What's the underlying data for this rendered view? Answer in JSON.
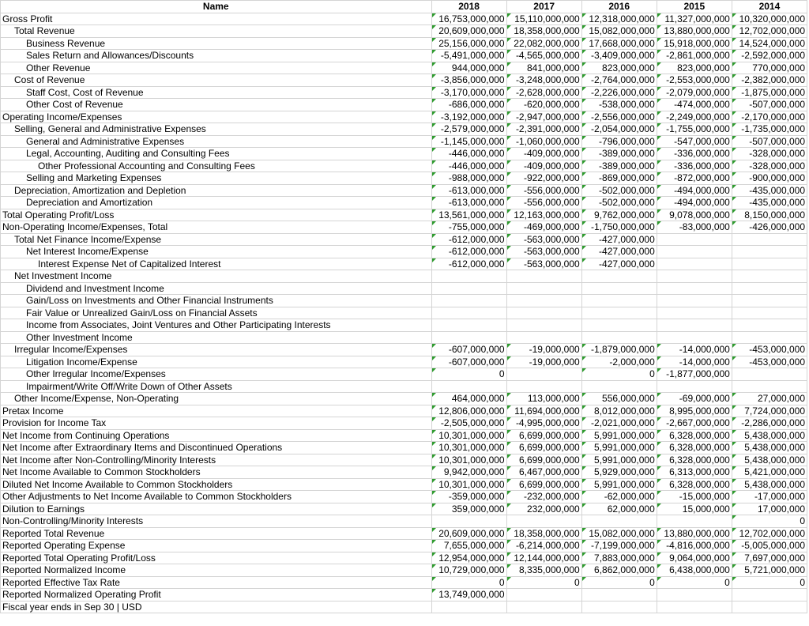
{
  "header": {
    "name": "Name",
    "years": [
      "2018",
      "2017",
      "2016",
      "2015",
      "2014"
    ]
  },
  "rows": [
    {
      "label": "Gross Profit",
      "indent": 0,
      "values": [
        "16,753,000,000",
        "15,110,000,000",
        "12,318,000,000",
        "11,327,000,000",
        "10,320,000,000"
      ]
    },
    {
      "label": "Total Revenue",
      "indent": 1,
      "values": [
        "20,609,000,000",
        "18,358,000,000",
        "15,082,000,000",
        "13,880,000,000",
        "12,702,000,000"
      ]
    },
    {
      "label": "Business Revenue",
      "indent": 2,
      "values": [
        "25,156,000,000",
        "22,082,000,000",
        "17,668,000,000",
        "15,918,000,000",
        "14,524,000,000"
      ]
    },
    {
      "label": "Sales Return and Allowances/Discounts",
      "indent": 2,
      "values": [
        "-5,491,000,000",
        "-4,565,000,000",
        "-3,409,000,000",
        "-2,861,000,000",
        "-2,592,000,000"
      ]
    },
    {
      "label": "Other Revenue",
      "indent": 2,
      "values": [
        "944,000,000",
        "841,000,000",
        "823,000,000",
        "823,000,000",
        "770,000,000"
      ]
    },
    {
      "label": "Cost of Revenue",
      "indent": 1,
      "values": [
        "-3,856,000,000",
        "-3,248,000,000",
        "-2,764,000,000",
        "-2,553,000,000",
        "-2,382,000,000"
      ]
    },
    {
      "label": "Staff Cost, Cost of Revenue",
      "indent": 2,
      "values": [
        "-3,170,000,000",
        "-2,628,000,000",
        "-2,226,000,000",
        "-2,079,000,000",
        "-1,875,000,000"
      ]
    },
    {
      "label": "Other Cost of Revenue",
      "indent": 2,
      "values": [
        "-686,000,000",
        "-620,000,000",
        "-538,000,000",
        "-474,000,000",
        "-507,000,000"
      ]
    },
    {
      "label": "Operating Income/Expenses",
      "indent": 0,
      "values": [
        "-3,192,000,000",
        "-2,947,000,000",
        "-2,556,000,000",
        "-2,249,000,000",
        "-2,170,000,000"
      ]
    },
    {
      "label": "Selling, General and Administrative Expenses",
      "indent": 1,
      "values": [
        "-2,579,000,000",
        "-2,391,000,000",
        "-2,054,000,000",
        "-1,755,000,000",
        "-1,735,000,000"
      ]
    },
    {
      "label": "General and Administrative Expenses",
      "indent": 2,
      "values": [
        "-1,145,000,000",
        "-1,060,000,000",
        "-796,000,000",
        "-547,000,000",
        "-507,000,000"
      ]
    },
    {
      "label": "Legal, Accounting, Auditing and Consulting Fees",
      "indent": 2,
      "values": [
        "-446,000,000",
        "-409,000,000",
        "-389,000,000",
        "-336,000,000",
        "-328,000,000"
      ]
    },
    {
      "label": "Other Professional Accounting and Consulting Fees",
      "indent": 3,
      "values": [
        "-446,000,000",
        "-409,000,000",
        "-389,000,000",
        "-336,000,000",
        "-328,000,000"
      ]
    },
    {
      "label": "Selling and Marketing Expenses",
      "indent": 2,
      "values": [
        "-988,000,000",
        "-922,000,000",
        "-869,000,000",
        "-872,000,000",
        "-900,000,000"
      ]
    },
    {
      "label": "Depreciation, Amortization and Depletion",
      "indent": 1,
      "values": [
        "-613,000,000",
        "-556,000,000",
        "-502,000,000",
        "-494,000,000",
        "-435,000,000"
      ]
    },
    {
      "label": "Depreciation and Amortization",
      "indent": 2,
      "values": [
        "-613,000,000",
        "-556,000,000",
        "-502,000,000",
        "-494,000,000",
        "-435,000,000"
      ]
    },
    {
      "label": "Total Operating Profit/Loss",
      "indent": 0,
      "values": [
        "13,561,000,000",
        "12,163,000,000",
        "9,762,000,000",
        "9,078,000,000",
        "8,150,000,000"
      ]
    },
    {
      "label": "Non-Operating Income/Expenses, Total",
      "indent": 0,
      "values": [
        "-755,000,000",
        "-469,000,000",
        "-1,750,000,000",
        "-83,000,000",
        "-426,000,000"
      ]
    },
    {
      "label": "Total Net Finance Income/Expense",
      "indent": 1,
      "values": [
        "-612,000,000",
        "-563,000,000",
        "-427,000,000",
        "",
        ""
      ]
    },
    {
      "label": "Net Interest Income/Expense",
      "indent": 2,
      "values": [
        "-612,000,000",
        "-563,000,000",
        "-427,000,000",
        "",
        ""
      ]
    },
    {
      "label": "Interest Expense Net of Capitalized Interest",
      "indent": 3,
      "values": [
        "-612,000,000",
        "-563,000,000",
        "-427,000,000",
        "",
        ""
      ]
    },
    {
      "label": "Net Investment Income",
      "indent": 1,
      "values": [
        "",
        "",
        "",
        "",
        ""
      ]
    },
    {
      "label": "Dividend and Investment Income",
      "indent": 2,
      "values": [
        "",
        "",
        "",
        "",
        ""
      ]
    },
    {
      "label": "Gain/Loss on Investments and Other Financial Instruments",
      "indent": 2,
      "values": [
        "",
        "",
        "",
        "",
        ""
      ]
    },
    {
      "label": "Fair Value or Unrealized Gain/Loss on Financial Assets",
      "indent": 2,
      "values": [
        "",
        "",
        "",
        "",
        ""
      ]
    },
    {
      "label": "Income from Associates, Joint Ventures and Other Participating Interests",
      "indent": 2,
      "values": [
        "",
        "",
        "",
        "",
        ""
      ]
    },
    {
      "label": "Other Investment Income",
      "indent": 2,
      "values": [
        "",
        "",
        "",
        "",
        ""
      ]
    },
    {
      "label": "Irregular Income/Expenses",
      "indent": 1,
      "values": [
        "-607,000,000",
        "-19,000,000",
        "-1,879,000,000",
        "-14,000,000",
        "-453,000,000"
      ]
    },
    {
      "label": "Litigation Income/Expense",
      "indent": 2,
      "values": [
        "-607,000,000",
        "-19,000,000",
        "-2,000,000",
        "-14,000,000",
        "-453,000,000"
      ]
    },
    {
      "label": "Other Irregular Income/Expenses",
      "indent": 2,
      "values": [
        "0",
        "",
        "0",
        "-1,877,000,000",
        ""
      ]
    },
    {
      "label": "Impairment/Write Off/Write Down of Other Assets",
      "indent": 2,
      "values": [
        "",
        "",
        "",
        "",
        ""
      ]
    },
    {
      "label": "Other Income/Expense, Non-Operating",
      "indent": 1,
      "values": [
        "464,000,000",
        "113,000,000",
        "556,000,000",
        "-69,000,000",
        "27,000,000"
      ]
    },
    {
      "label": "Pretax Income",
      "indent": 0,
      "values": [
        "12,806,000,000",
        "11,694,000,000",
        "8,012,000,000",
        "8,995,000,000",
        "7,724,000,000"
      ]
    },
    {
      "label": "Provision for Income Tax",
      "indent": 0,
      "values": [
        "-2,505,000,000",
        "-4,995,000,000",
        "-2,021,000,000",
        "-2,667,000,000",
        "-2,286,000,000"
      ]
    },
    {
      "label": "Net Income from Continuing Operations",
      "indent": 0,
      "values": [
        "10,301,000,000",
        "6,699,000,000",
        "5,991,000,000",
        "6,328,000,000",
        "5,438,000,000"
      ]
    },
    {
      "label": "Net Income after Extraordinary Items and Discontinued Operations",
      "indent": 0,
      "values": [
        "10,301,000,000",
        "6,699,000,000",
        "5,991,000,000",
        "6,328,000,000",
        "5,438,000,000"
      ]
    },
    {
      "label": "Net Income after Non-Controlling/Minority Interests",
      "indent": 0,
      "values": [
        "10,301,000,000",
        "6,699,000,000",
        "5,991,000,000",
        "6,328,000,000",
        "5,438,000,000"
      ]
    },
    {
      "label": "Net Income Available to Common Stockholders",
      "indent": 0,
      "values": [
        "9,942,000,000",
        "6,467,000,000",
        "5,929,000,000",
        "6,313,000,000",
        "5,421,000,000"
      ]
    },
    {
      "label": "Diluted Net Income Available to Common Stockholders",
      "indent": 0,
      "values": [
        "10,301,000,000",
        "6,699,000,000",
        "5,991,000,000",
        "6,328,000,000",
        "5,438,000,000"
      ]
    },
    {
      "label": "Other Adjustments to Net Income Available to Common Stockholders",
      "indent": 0,
      "values": [
        "-359,000,000",
        "-232,000,000",
        "-62,000,000",
        "-15,000,000",
        "-17,000,000"
      ]
    },
    {
      "label": "Dilution to Earnings",
      "indent": 0,
      "values": [
        "359,000,000",
        "232,000,000",
        "62,000,000",
        "15,000,000",
        "17,000,000"
      ]
    },
    {
      "label": "Non-Controlling/Minority Interests",
      "indent": 0,
      "values": [
        "",
        "",
        "",
        "",
        "0"
      ]
    },
    {
      "label": "Reported Total Revenue",
      "indent": 0,
      "values": [
        "20,609,000,000",
        "18,358,000,000",
        "15,082,000,000",
        "13,880,000,000",
        "12,702,000,000"
      ]
    },
    {
      "label": "Reported Operating Expense",
      "indent": 0,
      "values": [
        "7,655,000,000",
        "-6,214,000,000",
        "-7,199,000,000",
        "-4,816,000,000",
        "-5,005,000,000"
      ]
    },
    {
      "label": "Reported Total Operating Profit/Loss",
      "indent": 0,
      "values": [
        "12,954,000,000",
        "12,144,000,000",
        "7,883,000,000",
        "9,064,000,000",
        "7,697,000,000"
      ]
    },
    {
      "label": "Reported Normalized Income",
      "indent": 0,
      "values": [
        "10,729,000,000",
        "8,335,000,000",
        "6,862,000,000",
        "6,438,000,000",
        "5,721,000,000"
      ]
    },
    {
      "label": "Reported Effective Tax Rate",
      "indent": 0,
      "values": [
        "0",
        "0",
        "0",
        "0",
        "0"
      ]
    },
    {
      "label": "Reported Normalized Operating Profit",
      "indent": 0,
      "values": [
        "13,749,000,000",
        "",
        "",
        "",
        ""
      ]
    },
    {
      "label": "Fiscal year ends in Sep 30 | USD",
      "indent": 0,
      "values": [
        "",
        "",
        "",
        "",
        ""
      ]
    }
  ]
}
